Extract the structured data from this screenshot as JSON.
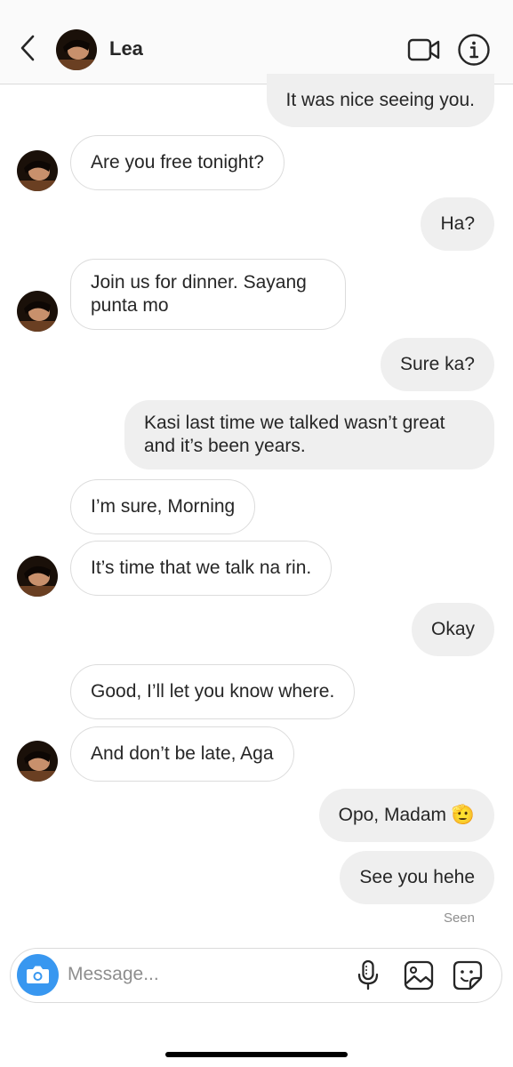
{
  "header": {
    "contact_name": "Lea",
    "icons": [
      "back-arrow-icon",
      "avatar",
      "video-call-icon",
      "info-icon"
    ]
  },
  "messages": [
    {
      "side": "out",
      "text": "It was nice seeing you."
    },
    {
      "side": "in",
      "text": "Are you free tonight?"
    },
    {
      "side": "out",
      "text": "Ha?"
    },
    {
      "side": "in",
      "text": "Join us for dinner. Sayang punta mo"
    },
    {
      "side": "out",
      "text": "Sure ka?"
    },
    {
      "side": "out",
      "text": "Kasi last time we talked wasn’t great and it’s been years."
    },
    {
      "side": "in",
      "text": "I’m sure, Morning"
    },
    {
      "side": "in",
      "text": "It’s time that we talk na rin."
    },
    {
      "side": "out",
      "text": "Okay"
    },
    {
      "side": "in",
      "text": "Good, I’ll let you know where."
    },
    {
      "side": "in",
      "text": "And don’t be late, Aga"
    },
    {
      "side": "out",
      "text": "Opo, Madam",
      "emoji": "🫡"
    },
    {
      "side": "out",
      "text": "See you hehe"
    }
  ],
  "seen_label": "Seen",
  "composer": {
    "placeholder": "Message...",
    "icons": [
      "camera-icon",
      "microphone-icon",
      "gallery-icon",
      "sticker-icon"
    ],
    "camera_color": "#3897f0"
  }
}
